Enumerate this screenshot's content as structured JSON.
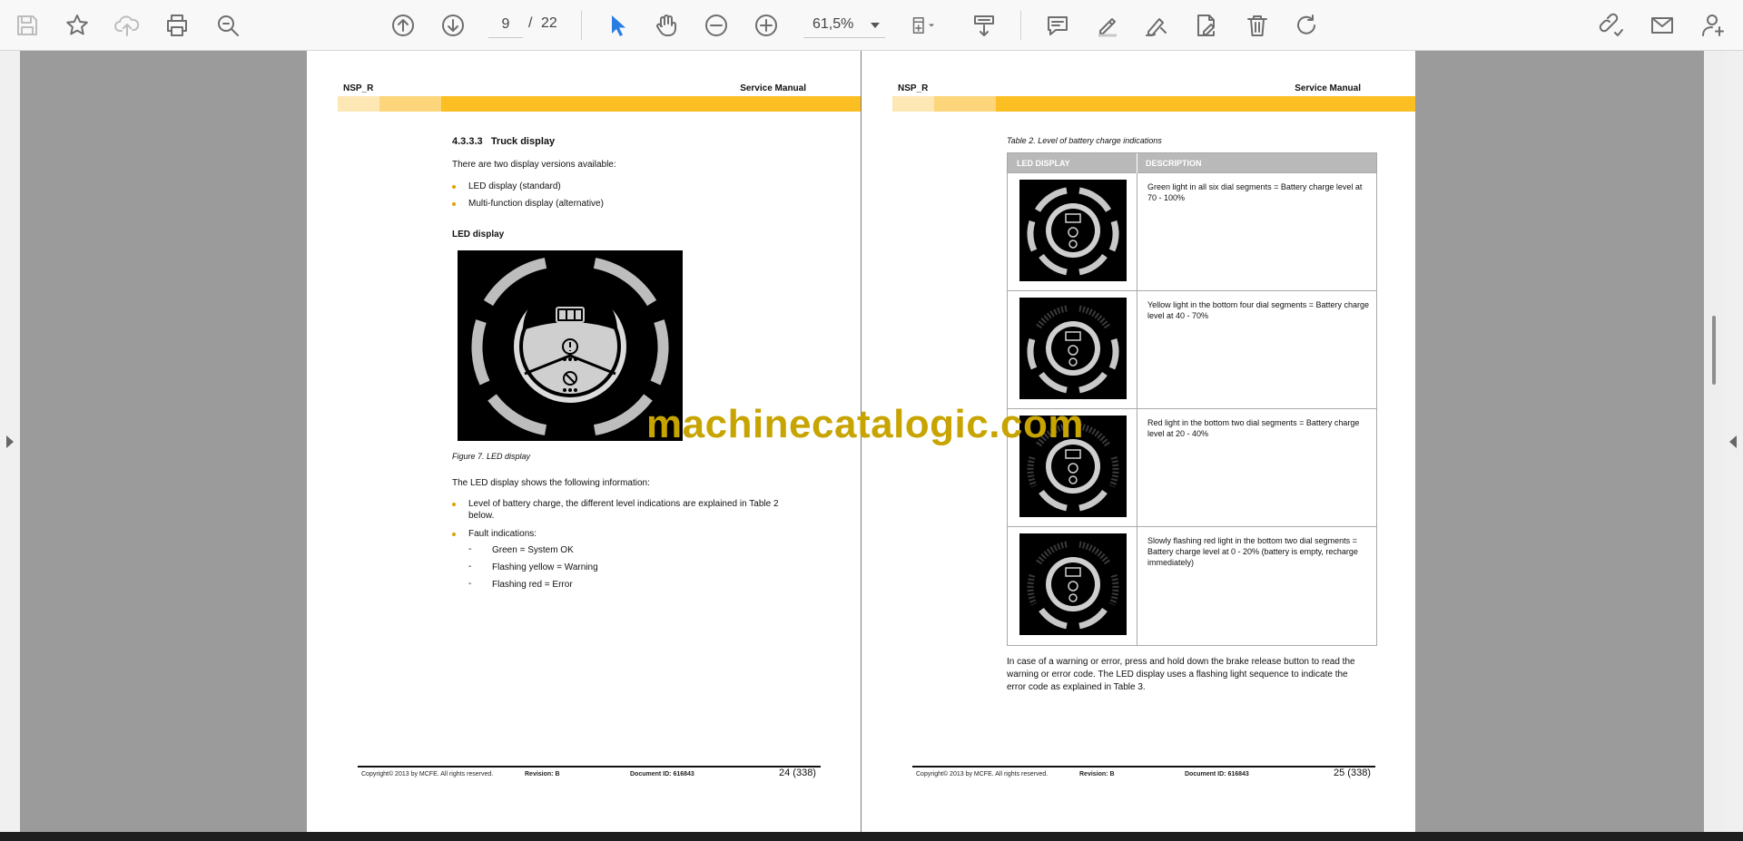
{
  "toolbar": {
    "icons": [
      "save-icon",
      "bookmark-star-icon",
      "upload-cloud-icon",
      "print-icon",
      "zoom-search-icon",
      "previous-page-icon",
      "next-page-icon",
      "select-cursor-icon",
      "hand-tool-icon",
      "zoom-out-icon",
      "zoom-in-icon",
      "page-fit-icon",
      "scroll-mode-icon",
      "comment-icon",
      "highlight-pen-icon",
      "draw-icon",
      "fill-sign-icon",
      "delete-icon",
      "rotate-icon",
      "share-link-icon",
      "email-icon",
      "add-user-icon"
    ],
    "current_page": "9",
    "page_separator": "/",
    "total_pages": "22",
    "zoom": "61,5%"
  },
  "page_left": {
    "header_left": "NSP_R",
    "header_right": "Service Manual",
    "section_number": "4.3.3.3",
    "section_title": "Truck display",
    "intro": "There are two display versions available:",
    "versions": [
      "LED display (standard)",
      "Multi-function display (alternative)"
    ],
    "subheading": "LED display",
    "figure_caption": "Figure 7. LED display",
    "shows_info": "The LED display shows the following information:",
    "info_item_1_line1": "Level of battery charge, the different level indications are explained in Table 2",
    "info_item_1_line2": "below.",
    "info_item_2": "Fault indications:",
    "fault_dash": "-",
    "faults": [
      "Green = System OK",
      "Flashing yellow = Warning",
      "Flashing red = Error"
    ],
    "footer_copyright": "Copyright© 2013 by MCFE. All rights reserved.",
    "footer_revision": "Revision: B",
    "footer_document": "Document ID: 616843",
    "footer_page": "24 (338)"
  },
  "page_right": {
    "header_left": "NSP_R",
    "header_right": "Service Manual",
    "table_caption": "Table 2. Level of battery charge indications",
    "table_headers": [
      "LED DISPLAY",
      "DESCRIPTION"
    ],
    "table_rows": [
      {
        "description": "Green light in all six dial segments = Battery charge level at 70 - 100%",
        "lit_segments": 6
      },
      {
        "description": "Yellow light in the bottom four dial segments = Battery charge level at 40 - 70%",
        "lit_segments": 4
      },
      {
        "description": "Red light in the bottom two dial segments = Battery charge level at 20 - 40%",
        "lit_segments": 2
      },
      {
        "description": "Slowly flashing red light in the bottom two dial segments = Battery charge level at 0 - 20% (battery is empty, recharge immediately)",
        "lit_segments": 2
      }
    ],
    "after_table_lines": [
      "In case of a warning or error, press and hold down the brake release button to read the",
      "warning or error code. The LED display uses a flashing light sequence to indicate the",
      "error code as explained in Table 3."
    ],
    "footer_copyright": "Copyright© 2013 by MCFE. All rights reserved.",
    "footer_revision": "Revision: B",
    "footer_document": "Document ID: 616843",
    "footer_page": "25 (338)"
  },
  "watermark": "machinecatalogic.com",
  "colors": {
    "accent_band": "#fbbf24",
    "select_tool": "#2a7de1",
    "watermark": "#c8a400"
  }
}
